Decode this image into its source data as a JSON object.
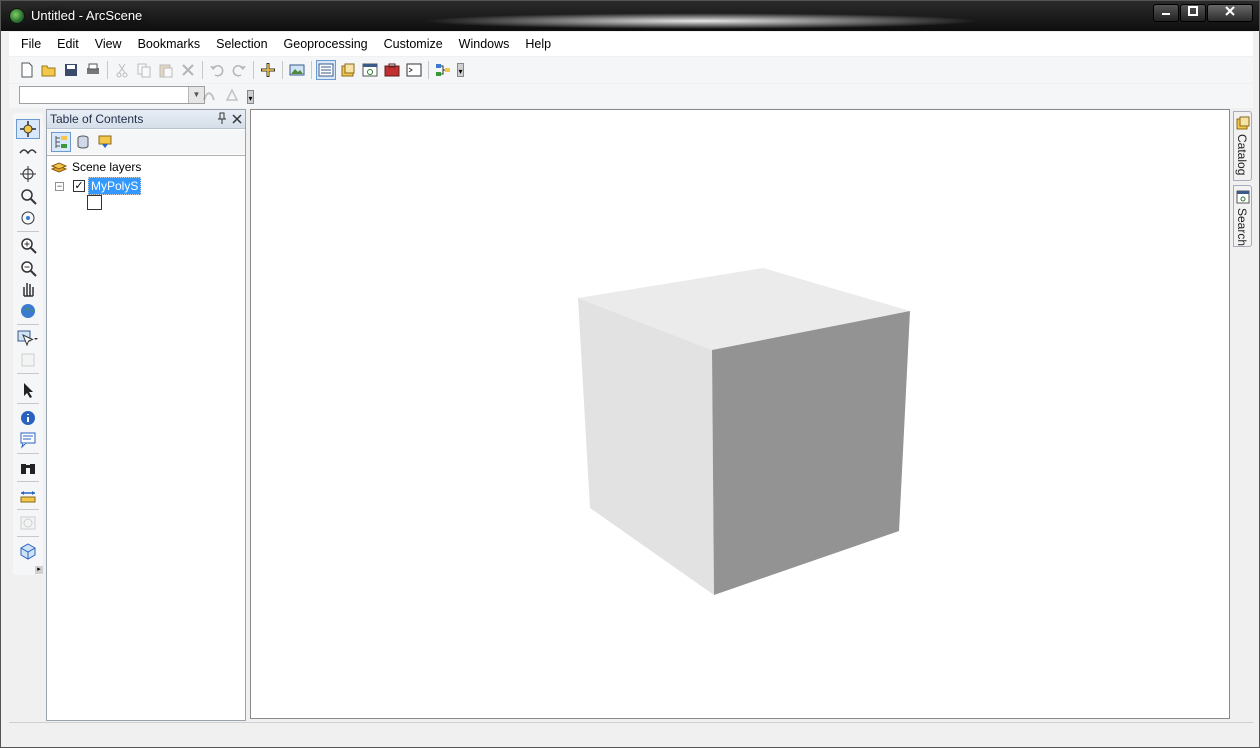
{
  "window": {
    "title": "Untitled - ArcScene"
  },
  "menu": [
    "File",
    "Edit",
    "View",
    "Bookmarks",
    "Selection",
    "Geoprocessing",
    "Customize",
    "Windows",
    "Help"
  ],
  "toc": {
    "title": "Table of Contents",
    "group_label": "Scene layers",
    "layer": {
      "name": "MyPolyS",
      "checked": true,
      "expanded": true
    }
  },
  "right_dock": {
    "tabs": [
      "Catalog",
      "Search"
    ]
  },
  "colors": {
    "selection": "#3399ff",
    "cube_left": "#e2e2e2",
    "cube_top": "#ebebeb",
    "cube_right": "#939393"
  }
}
